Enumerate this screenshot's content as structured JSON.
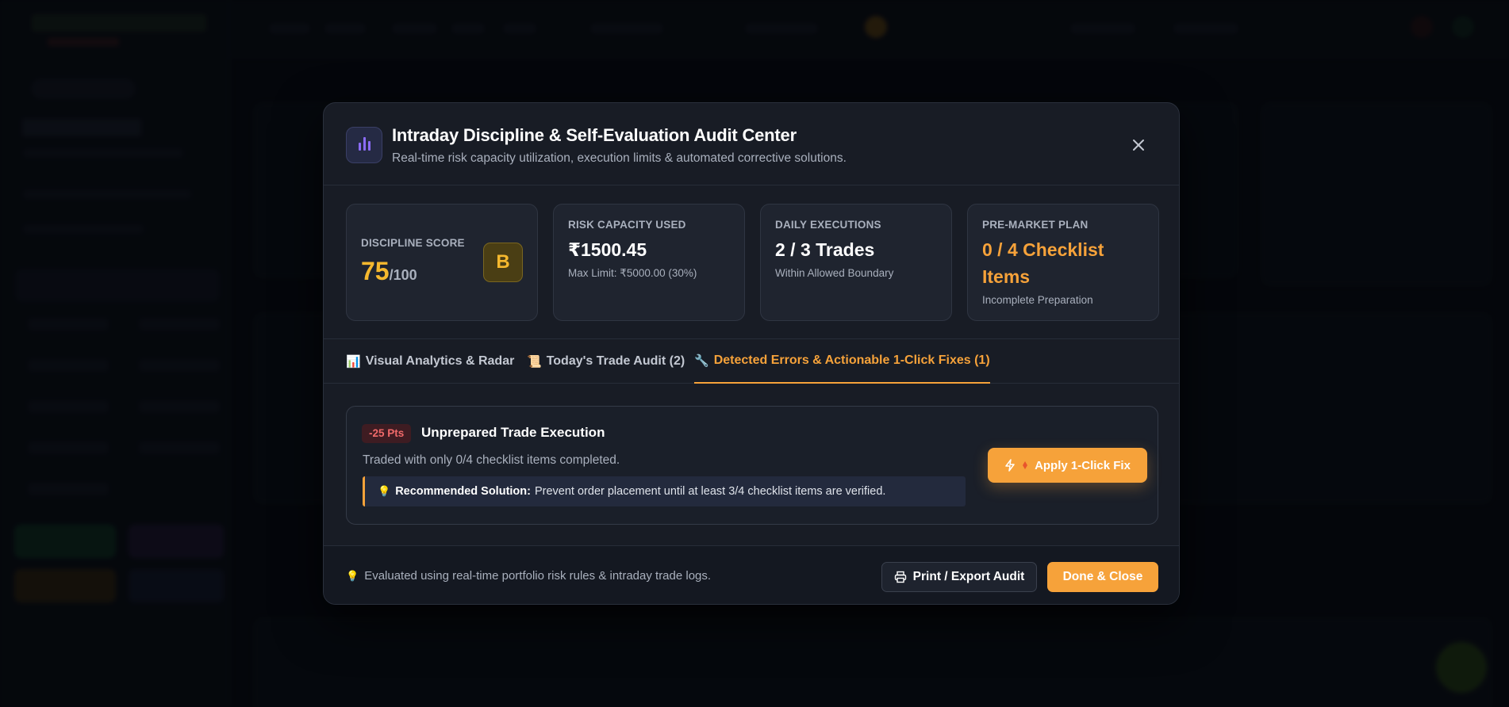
{
  "modal": {
    "title": "Intraday Discipline & Self-Evaluation Audit Center",
    "subtitle": "Real-time risk capacity utilization, execution limits & automated corrective solutions.",
    "close_icon": "close-icon"
  },
  "stats": {
    "discipline": {
      "label": "DISCIPLINE SCORE",
      "score": "75",
      "out_of": "/100",
      "grade": "B",
      "score_color": "#f5b82e"
    },
    "risk": {
      "label": "RISK CAPACITY USED",
      "value": "₹1500.45",
      "sub": "Max Limit: ₹5000.00 (30%)"
    },
    "executions": {
      "label": "DAILY EXECUTIONS",
      "value": "2 / 3 Trades",
      "sub": "Within Allowed Boundary"
    },
    "plan": {
      "label": "PRE-MARKET PLAN",
      "value_line1": "0 / 4 Checklist",
      "value_line2": "Items",
      "sub": "Incomplete Preparation",
      "value_color": "#f6a23a"
    }
  },
  "tabs": [
    {
      "icon": "📊",
      "label": "Visual Analytics & Radar",
      "active": false
    },
    {
      "icon": "📜",
      "label": "Today's Trade Audit (2)",
      "active": false
    },
    {
      "icon": "🔧",
      "label": "Detected Errors & Actionable 1-Click Fixes (1)",
      "active": true
    }
  ],
  "error": {
    "badge": "-25 Pts",
    "title": "Unprepared Trade Execution",
    "description": "Traded with only 0/4 checklist items completed.",
    "solution_label": "Recommended Solution:",
    "solution_text": "Prevent order placement until at least 3/4 checklist items are verified.",
    "fix_button": "Apply 1-Click Fix"
  },
  "footer": {
    "note": "Evaluated using real-time portfolio risk rules & intraday trade logs.",
    "print_button": "Print / Export Audit",
    "done_button": "Done & Close"
  },
  "colors": {
    "accent": "#f6a23a",
    "danger": "#f06a6a",
    "purple": "#8b6cf6"
  }
}
